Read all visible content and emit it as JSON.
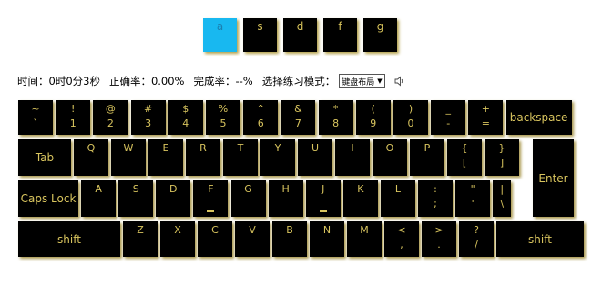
{
  "target_keys": [
    {
      "label": "a",
      "current": true
    },
    {
      "label": "s",
      "current": false
    },
    {
      "label": "d",
      "current": false
    },
    {
      "label": "f",
      "current": false
    },
    {
      "label": "g",
      "current": false
    }
  ],
  "status": {
    "time_label": "时间：",
    "time_value": "0时0分3秒",
    "accuracy_label": "正确率：",
    "accuracy_value": "0.00%",
    "completion_label": "完成率：",
    "completion_value": "--%",
    "mode_label": "选择练习模式：",
    "mode_selected": "键盘布局",
    "sound_icon": "speaker-icon"
  },
  "keyboard": {
    "rows": [
      [
        {
          "top": "~",
          "bot": "`"
        },
        {
          "top": "!",
          "bot": "1"
        },
        {
          "top": "@",
          "bot": "2"
        },
        {
          "top": "#",
          "bot": "3"
        },
        {
          "top": "$",
          "bot": "4"
        },
        {
          "top": "%",
          "bot": "5"
        },
        {
          "top": "^",
          "bot": "6"
        },
        {
          "top": "&",
          "bot": "7"
        },
        {
          "top": "*",
          "bot": "8"
        },
        {
          "top": "(",
          "bot": "9"
        },
        {
          "top": ")",
          "bot": "0"
        },
        {
          "top": "_",
          "bot": "-"
        },
        {
          "top": "+",
          "bot": "="
        },
        {
          "label": "backspace"
        }
      ],
      [
        {
          "label": "Tab"
        },
        {
          "top": "Q"
        },
        {
          "top": "W"
        },
        {
          "top": "E"
        },
        {
          "top": "R"
        },
        {
          "top": "T"
        },
        {
          "top": "Y"
        },
        {
          "top": "U"
        },
        {
          "top": "I"
        },
        {
          "top": "O"
        },
        {
          "top": "P"
        },
        {
          "top": "{",
          "bot": "["
        },
        {
          "top": "}",
          "bot": "]"
        }
      ],
      [
        {
          "label": "Caps Lock"
        },
        {
          "top": "A"
        },
        {
          "top": "S"
        },
        {
          "top": "D"
        },
        {
          "top": "F",
          "home": true
        },
        {
          "top": "G"
        },
        {
          "top": "H"
        },
        {
          "top": "J",
          "home": true
        },
        {
          "top": "K"
        },
        {
          "top": "L"
        },
        {
          "top": ":",
          "bot": ";"
        },
        {
          "top": "\"",
          "bot": "'"
        },
        {
          "top": "|",
          "bot": "\\"
        },
        {
          "label": "Enter"
        }
      ],
      [
        {
          "label": "shift"
        },
        {
          "top": "Z"
        },
        {
          "top": "X"
        },
        {
          "top": "C"
        },
        {
          "top": "V"
        },
        {
          "top": "B"
        },
        {
          "top": "N"
        },
        {
          "top": "M"
        },
        {
          "top": "<",
          "bot": ","
        },
        {
          "top": ">",
          "bot": "."
        },
        {
          "top": "?",
          "bot": "/"
        },
        {
          "label": "shift"
        }
      ]
    ]
  }
}
